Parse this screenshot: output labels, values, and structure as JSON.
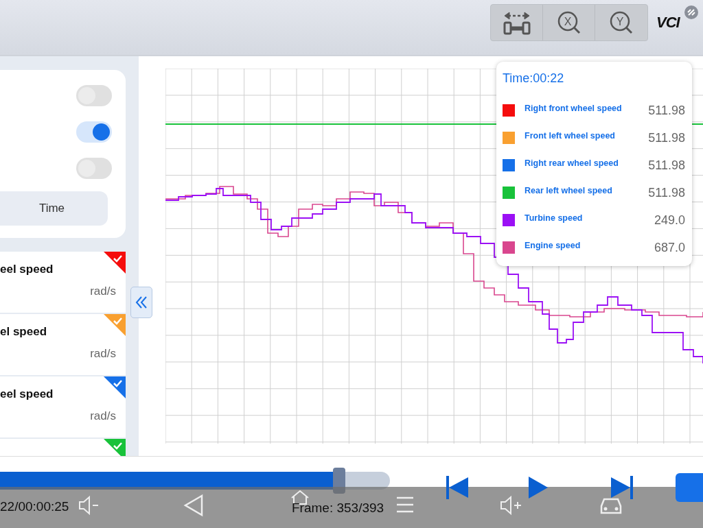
{
  "toolbar": {
    "buttons": [
      {
        "kind": "width"
      },
      {
        "kind": "zoom",
        "letter": "X"
      },
      {
        "kind": "zoom",
        "letter": "Y"
      }
    ],
    "vci_label": "VCI"
  },
  "settings": {
    "toggles": [
      {
        "on": false
      },
      {
        "on": true
      },
      {
        "on": false
      }
    ],
    "axis_button": "Time"
  },
  "sensors": [
    {
      "name": "eel speed",
      "unit": "rad/s",
      "color": "#f50d0d",
      "checked": true
    },
    {
      "name": "el speed",
      "unit": "rad/s",
      "color": "#f9a030",
      "checked": true
    },
    {
      "name": "eel speed",
      "unit": "rad/s",
      "color": "#1670e8",
      "checked": true
    },
    {
      "color": "#18c23a",
      "checked": true
    }
  ],
  "legend": {
    "time": "Time:00:22",
    "items": [
      {
        "name": "Right front wheel speed",
        "value": "511.98",
        "color": "#f50d0d"
      },
      {
        "name": "Front left wheel speed",
        "value": "511.98",
        "color": "#f9a030"
      },
      {
        "name": "Right rear wheel speed",
        "value": "511.98",
        "color": "#1670e8"
      },
      {
        "name": "Rear left wheel speed",
        "value": "511.98",
        "color": "#18c23a"
      },
      {
        "name": "Turbine speed",
        "value": "249.0",
        "color": "#9b10f5"
      },
      {
        "name": "Engine speed",
        "value": "687.0",
        "color": "#d9468e"
      }
    ]
  },
  "playback": {
    "level": 0.87
  },
  "nav_bar": {
    "time": "22/00:00:25",
    "frame": "Frame: 353/393"
  }
}
